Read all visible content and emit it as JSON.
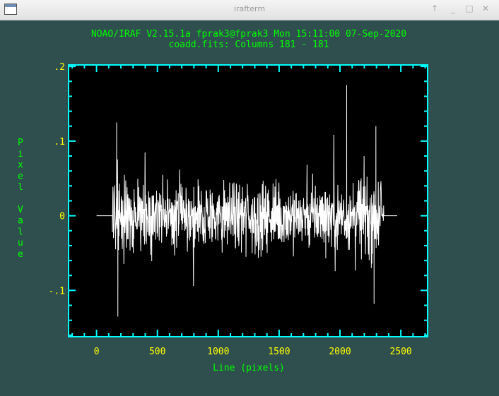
{
  "window": {
    "title": "irafterm",
    "controls": [
      "↑",
      "_",
      "□",
      "✕"
    ]
  },
  "plot": {
    "header_line1": "NOAO/IRAF V2.15.1a fprak3@fprak3 Mon 15:11:00 07-Sep-2020",
    "header_line2": "coadd.fits: Columns 181 - 181",
    "x_tick_labels": [
      "0",
      "500",
      "1000",
      "1500",
      "2000",
      "2500"
    ],
    "y_tick_labels": [
      ".2",
      ".1",
      "0",
      "-.1"
    ],
    "colors": {
      "background": "#2f4f4f",
      "frame": "#00ffff",
      "text": "#00ff00",
      "tick_labels": "#ffff00",
      "data": "#ffffff",
      "plot_bg": "#000000"
    }
  },
  "chart_data": {
    "type": "line",
    "title": "coadd.fits: Columns 181 - 181",
    "xlabel": "Line (pixels)",
    "ylabel": "Pixel Value",
    "xlim": [
      -230,
      2720
    ],
    "ylim": [
      -0.162,
      0.202
    ],
    "x_ticks": [
      0,
      500,
      1000,
      1500,
      2000,
      2500
    ],
    "y_ticks": [
      -0.1,
      0,
      0.1,
      0.2
    ],
    "grid": false,
    "series": [
      {
        "x_range": [
          0,
          2470
        ],
        "flat_segments": [
          [
            0,
            130,
            0
          ],
          [
            2360,
            2470,
            0
          ]
        ],
        "noise_range": [
          130,
          2360
        ],
        "typical_amplitude": 0.04,
        "extremes": [
          {
            "x": 165,
            "y": 0.125
          },
          {
            "x": 175,
            "y": -0.135
          },
          {
            "x": 2055,
            "y": 0.175
          },
          {
            "x": 2295,
            "y": 0.12
          },
          {
            "x": 2280,
            "y": -0.118
          }
        ]
      }
    ]
  }
}
